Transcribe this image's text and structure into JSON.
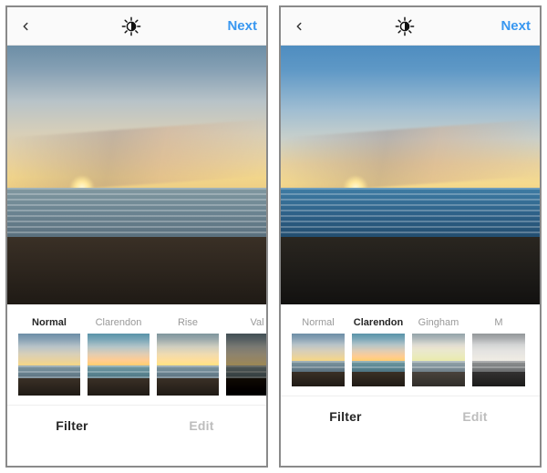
{
  "screens": [
    {
      "header": {
        "next_label": "Next"
      },
      "filters": [
        {
          "label": "Normal",
          "selected": true
        },
        {
          "label": "Clarendon",
          "selected": false
        },
        {
          "label": "Rise",
          "selected": false
        },
        {
          "label": "Val",
          "selected": false
        }
      ],
      "tabs": {
        "filter_label": "Filter",
        "edit_label": "Edit",
        "selected": "filter"
      }
    },
    {
      "header": {
        "next_label": "Next"
      },
      "filters": [
        {
          "label": "Normal",
          "selected": false
        },
        {
          "label": "Clarendon",
          "selected": true
        },
        {
          "label": "Gingham",
          "selected": false
        },
        {
          "label": "M",
          "selected": false
        }
      ],
      "tabs": {
        "filter_label": "Filter",
        "edit_label": "Edit",
        "selected": "filter"
      }
    }
  ]
}
